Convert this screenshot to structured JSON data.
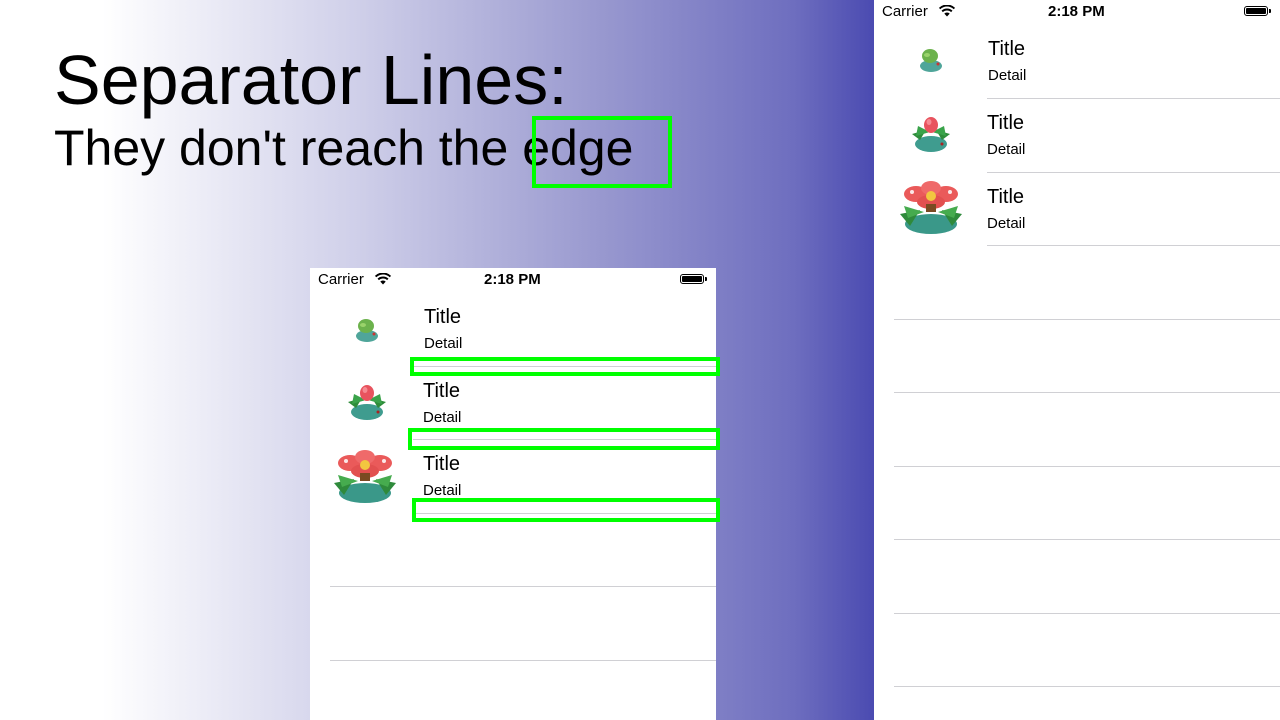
{
  "headline": {
    "line1": "Separator Lines:",
    "line2_prefix": "They don't reach the",
    "line2_highlight": "edge"
  },
  "status_bar": {
    "carrier": "Carrier",
    "time": "2:18 PM"
  },
  "rows": [
    {
      "title": "Title",
      "detail": "Detail",
      "icon": "bulbasaur-sprite"
    },
    {
      "title": "Title",
      "detail": "Detail",
      "icon": "ivysaur-sprite"
    },
    {
      "title": "Title",
      "detail": "Detail",
      "icon": "venusaur-sprite"
    }
  ],
  "colors": {
    "highlight": "#00ff00",
    "background_gradient_end": "#4141ad",
    "separator": "#d0d0d4"
  }
}
